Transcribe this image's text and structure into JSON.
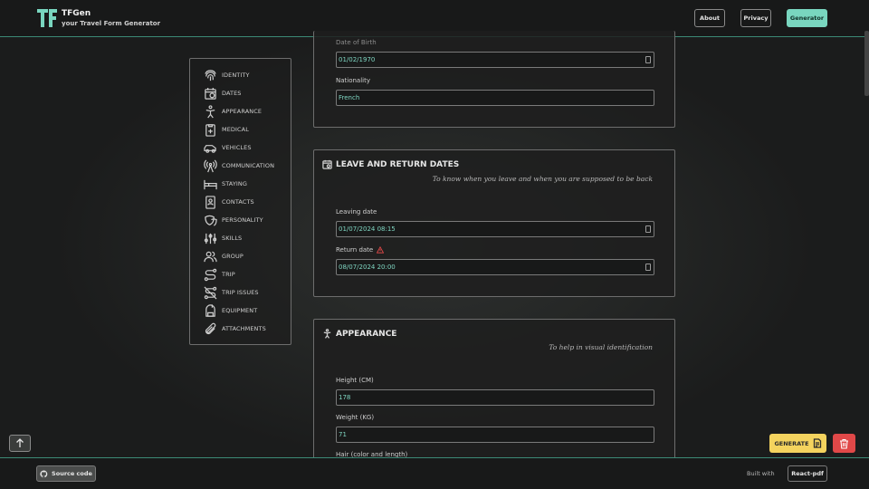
{
  "app": {
    "name": "TFGen",
    "tagline": "your Travel Form Generator"
  },
  "nav": {
    "about": "About",
    "privacy": "Privacy",
    "generator": "Generator"
  },
  "sidebar": {
    "items": [
      {
        "label": "IDENTITY",
        "icon": "fingerprint-icon"
      },
      {
        "label": "DATES",
        "icon": "calendar-icon"
      },
      {
        "label": "APPEARANCE",
        "icon": "person-icon"
      },
      {
        "label": "MEDICAL",
        "icon": "medical-clipboard-icon"
      },
      {
        "label": "VEHICLES",
        "icon": "car-icon"
      },
      {
        "label": "COMMUNICATION",
        "icon": "antenna-icon"
      },
      {
        "label": "STAYING",
        "icon": "bed-icon"
      },
      {
        "label": "CONTACTS",
        "icon": "contact-card-icon"
      },
      {
        "label": "PERSONALITY",
        "icon": "mask-icon"
      },
      {
        "label": "SKILLS",
        "icon": "sliders-icon"
      },
      {
        "label": "GROUP",
        "icon": "users-icon"
      },
      {
        "label": "TRIP",
        "icon": "route-icon"
      },
      {
        "label": "TRIP ISSUES",
        "icon": "route-off-icon"
      },
      {
        "label": "EQUIPMENT",
        "icon": "backpack-icon"
      },
      {
        "label": "ATTACHMENTS",
        "icon": "paperclip-icon"
      }
    ]
  },
  "identity": {
    "dob_label": "Date of Birth",
    "dob_value": "01/02/1970",
    "nationality_label": "Nationality",
    "nationality_value": "French"
  },
  "dates": {
    "title": "LEAVE AND RETURN DATES",
    "subtitle": "To know when you leave and when you are supposed to be back",
    "leaving_label": "Leaving date",
    "leaving_value": "01/07/2024 08:15",
    "return_label": "Return date",
    "return_value": "08/07/2024 20:00"
  },
  "appearance": {
    "title": "APPEARANCE",
    "subtitle": "To help in visual identification",
    "height_label": "Height (CM)",
    "height_value": "178",
    "weight_label": "Weight (KG)",
    "weight_value": "71",
    "hair_label": "Hair (color and length)"
  },
  "actions": {
    "generate": "GENERATE"
  },
  "footer": {
    "source": "Source code",
    "built_with": "Built with",
    "react_pdf": "React-pdf"
  },
  "colors": {
    "accent": "#79d6bf",
    "generate": "#f4d35e",
    "delete": "#e04848",
    "warning": "#e04848"
  }
}
